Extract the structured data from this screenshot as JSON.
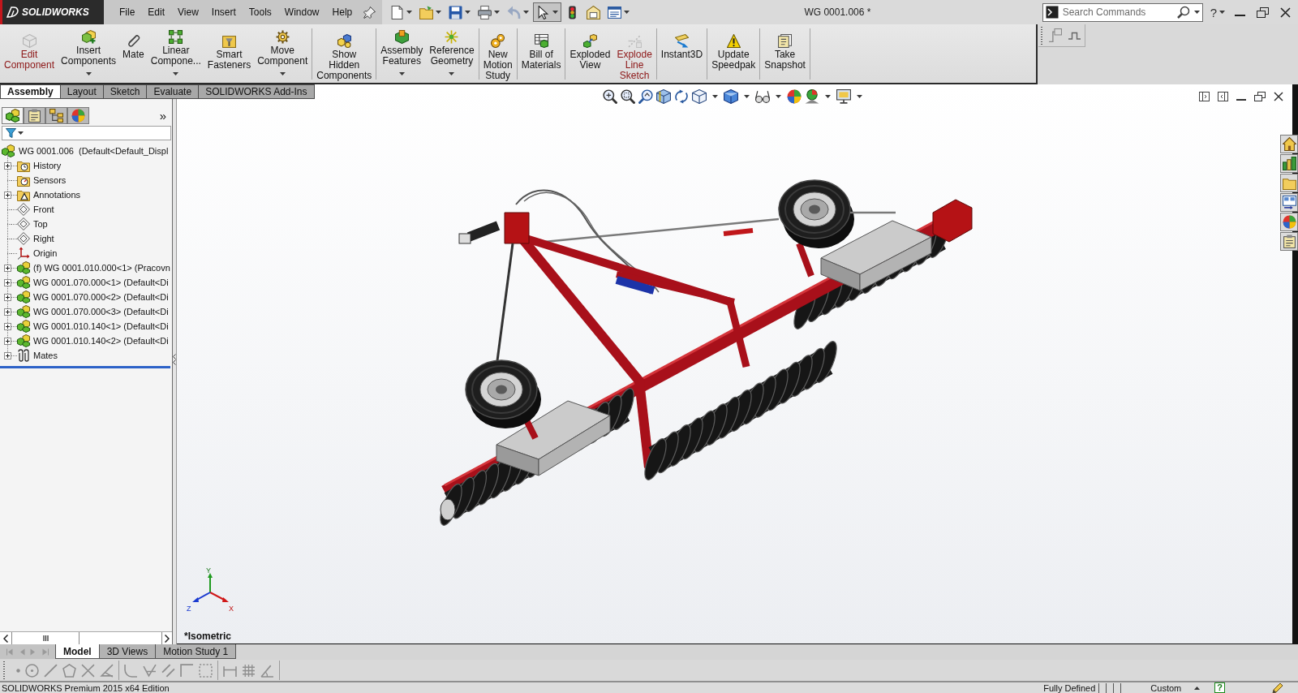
{
  "title_bar": {
    "logo": "SOLIDWORKS",
    "menu": [
      "File",
      "Edit",
      "View",
      "Insert",
      "Tools",
      "Window",
      "Help"
    ],
    "quick_access": [
      {
        "kind": "new",
        "dropdown": true,
        "disabled": false,
        "selected": false
      },
      {
        "kind": "open",
        "dropdown": true,
        "disabled": false,
        "selected": false
      },
      {
        "kind": "save",
        "dropdown": true,
        "disabled": false,
        "selected": false
      },
      {
        "kind": "print",
        "dropdown": true,
        "disabled": false,
        "selected": false
      },
      {
        "kind": "undo",
        "dropdown": true,
        "disabled": true,
        "selected": false
      },
      {
        "kind": "select",
        "dropdown": true,
        "disabled": false,
        "selected": true
      },
      {
        "kind": "rebuild",
        "dropdown": false,
        "disabled": false,
        "selected": false
      },
      {
        "kind": "properties",
        "dropdown": false,
        "disabled": false,
        "selected": false
      },
      {
        "kind": "options",
        "dropdown": true,
        "disabled": false,
        "selected": false
      }
    ],
    "document_title": "WG 0001.006 *",
    "search": {
      "placeholder": "Search Commands"
    },
    "help": "?"
  },
  "command_manager": {
    "groups": [
      {
        "commands": [
          {
            "kind": "edit",
            "lines": [
              "Edit",
              "Component"
            ],
            "dropdown": false,
            "disabled": true
          },
          {
            "kind": "insert",
            "lines": [
              "Insert",
              "Components"
            ],
            "dropdown": true,
            "disabled": false
          },
          {
            "kind": "mate",
            "lines": [
              "Mate"
            ],
            "dropdown": false,
            "disabled": false
          },
          {
            "kind": "pattern",
            "lines": [
              "Linear",
              "Compone..."
            ],
            "dropdown": true,
            "disabled": false
          },
          {
            "kind": "fasteners",
            "lines": [
              "Smart",
              "Fasteners"
            ],
            "dropdown": false,
            "disabled": false
          },
          {
            "kind": "move",
            "lines": [
              "Move",
              "Component"
            ],
            "dropdown": true,
            "disabled": false
          }
        ]
      },
      {
        "commands": [
          {
            "kind": "show",
            "lines": [
              "Show",
              "Hidden",
              "Components"
            ],
            "dropdown": false,
            "disabled": false
          }
        ]
      },
      {
        "commands": [
          {
            "kind": "features",
            "lines": [
              "Assembly",
              "Features"
            ],
            "dropdown": true,
            "disabled": false
          },
          {
            "kind": "reference",
            "lines": [
              "Reference",
              "Geometry"
            ],
            "dropdown": true,
            "disabled": false
          }
        ]
      },
      {
        "commands": [
          {
            "kind": "motion",
            "lines": [
              "New",
              "Motion",
              "Study"
            ],
            "dropdown": false,
            "disabled": false
          }
        ]
      },
      {
        "commands": [
          {
            "kind": "bom",
            "lines": [
              "Bill of",
              "Materials"
            ],
            "dropdown": false,
            "disabled": false
          }
        ]
      },
      {
        "commands": [
          {
            "kind": "explode",
            "lines": [
              "Exploded",
              "View"
            ],
            "dropdown": false,
            "disabled": false
          },
          {
            "kind": "explodesketch",
            "lines": [
              "Explode",
              "Line",
              "Sketch"
            ],
            "dropdown": false,
            "disabled": true
          }
        ]
      },
      {
        "commands": [
          {
            "kind": "instant3d",
            "lines": [
              "Instant3D"
            ],
            "dropdown": false,
            "disabled": false
          }
        ]
      },
      {
        "commands": [
          {
            "kind": "speedpak",
            "lines": [
              "Update",
              "Speedpak"
            ],
            "dropdown": false,
            "disabled": false
          }
        ]
      },
      {
        "commands": [
          {
            "kind": "snapshot",
            "lines": [
              "Take",
              "Snapshot"
            ],
            "dropdown": false,
            "disabled": false
          }
        ]
      }
    ]
  },
  "command_tabs": [
    {
      "label": "Assembly",
      "selected": true
    },
    {
      "label": "Layout",
      "selected": false
    },
    {
      "label": "Sketch",
      "selected": false
    },
    {
      "label": "Evaluate",
      "selected": false
    },
    {
      "label": "SOLIDWORKS Add-Ins",
      "selected": false
    }
  ],
  "feature_manager": {
    "tabs": [
      {
        "kind": "tree",
        "selected": true
      },
      {
        "kind": "properties",
        "selected": false
      },
      {
        "kind": "configurations",
        "selected": false
      },
      {
        "kind": "display",
        "selected": false
      }
    ],
    "more": "»",
    "tree": {
      "label": "WG 0001.006  (Default<Default_Displ",
      "kind": "assembly",
      "children": [
        {
          "label": "History",
          "kind": "history",
          "expandable": true,
          "expanded": false
        },
        {
          "label": "Sensors",
          "kind": "sensors",
          "expandable": false,
          "expanded": false
        },
        {
          "label": "Annotations",
          "kind": "annotations",
          "expandable": true,
          "expanded": false
        },
        {
          "label": "Front",
          "kind": "plane",
          "expandable": false,
          "expanded": false
        },
        {
          "label": "Top",
          "kind": "plane",
          "expandable": false,
          "expanded": false
        },
        {
          "label": "Right",
          "kind": "plane",
          "expandable": false,
          "expanded": false
        },
        {
          "label": "Origin",
          "kind": "origin",
          "expandable": false,
          "expanded": false
        },
        {
          "label": "(f) WG 0001.010.000<1> (Pracovn",
          "kind": "component",
          "expandable": true,
          "expanded": false
        },
        {
          "label": "WG 0001.070.000<1> (Default<Di",
          "kind": "component",
          "expandable": true,
          "expanded": false
        },
        {
          "label": "WG 0001.070.000<2> (Default<Di",
          "kind": "component",
          "expandable": true,
          "expanded": false
        },
        {
          "label": "WG 0001.070.000<3> (Default<Di",
          "kind": "component",
          "expandable": true,
          "expanded": false
        },
        {
          "label": "WG 0001.010.140<1> (Default<Di",
          "kind": "component",
          "expandable": true,
          "expanded": false
        },
        {
          "label": "WG 0001.010.140<2> (Default<Di",
          "kind": "component",
          "expandable": true,
          "expanded": false
        },
        {
          "label": "Mates",
          "kind": "mates",
          "expandable": true,
          "expanded": false
        }
      ]
    }
  },
  "graphics": {
    "view_label": "*Isometric",
    "triad": {
      "x": "X",
      "y": "Y",
      "z": "Z"
    }
  },
  "bottom_tabs": {
    "scroller_disabled": true,
    "tabs": [
      {
        "label": "Model",
        "selected": true
      },
      {
        "label": "3D Views",
        "selected": false
      },
      {
        "label": "Motion Study 1",
        "selected": false
      }
    ]
  },
  "sketch_toolbar": {
    "disabled": true
  },
  "status_bar": {
    "edition": "SOLIDWORKS Premium 2015 x64 Edition",
    "sketch_state": "Fully Defined",
    "units": "Custom",
    "help": "?"
  }
}
